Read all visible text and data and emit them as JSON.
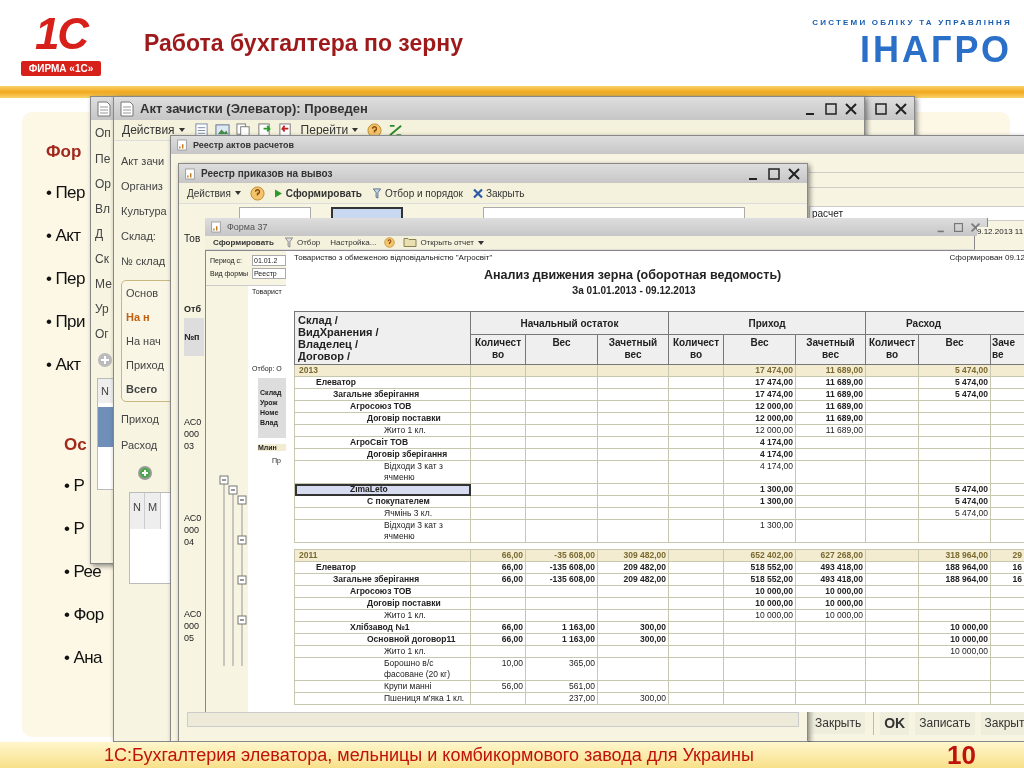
{
  "slide": {
    "title": "Работа бухгалтера по зерну",
    "footer": "1С:Бухгалтерия элеватора, мельницы и комбикормового завода для Украины",
    "page_number": "10"
  },
  "logo_left": {
    "mark": "1С",
    "caption": "ФИРМА «1С»"
  },
  "logo_right": {
    "tagline": "СИСТЕМИ ОБЛІКУ ТА УПРАВЛІННЯ",
    "name": "ІНАГРО"
  },
  "bullets_top": {
    "heading": "Фор",
    "items": [
      "• Пер",
      "• Акт",
      "• Пер",
      "• При",
      "• Акт"
    ]
  },
  "bullets_bottom": {
    "heading": "Ос",
    "items": [
      "• Р",
      "• Р",
      "• Рее",
      "• Фор",
      "• Ана"
    ]
  },
  "window_back": {
    "tab": "Оп",
    "labels": [
      "Пе",
      "Ор",
      "Вл",
      "Д",
      "Ск",
      "Ме",
      "Ур",
      "Ог"
    ],
    "table_header": "N"
  },
  "window_act": {
    "title": "Акт зачистки (Элеватор): Проведен",
    "actions": "Действия",
    "goto": "Перейти",
    "fields": [
      "Акт зачи",
      "Организ",
      "Культура",
      "Склад:",
      "№ склад"
    ],
    "group_tab": "Основ",
    "group_title": "На н",
    "group_rows": [
      "На нач",
      "Приход",
      "Всего"
    ],
    "rows": [
      "Приход",
      "Расход"
    ],
    "table_headers": [
      "N",
      "М"
    ]
  },
  "window_acts_registry": {
    "title": "Реестр актов расчетов",
    "field_value": "расчет",
    "date_text": "9.12.2013 11",
    "close_button": "Закрыть",
    "ok_button": "OK",
    "save_button": "Записать",
    "close_button_2": "Закрыт"
  },
  "window_orders": {
    "title": "Реестр приказов на вывоз",
    "actions": "Действия",
    "generate": "Сформировать",
    "filter": "Отбор и порядок",
    "close": "Закрыть",
    "tab": "Тов",
    "filter_header": "Отб",
    "number_header": "№п",
    "doc_numbers": [
      "АС0\n000\n03",
      "АС0\n000\n04",
      "АС0\n000\n05"
    ]
  },
  "window_form": {
    "title": "Форма 37",
    "generate": "Сформировать",
    "filter": "Отбор",
    "settings": "Настройка...",
    "open_report": "Открыть отчет",
    "period_label": "Период с:",
    "period_value": "01.01.2",
    "form_label": "Вид формы",
    "form_value": "Реестр",
    "preview": {
      "company": "Товарист",
      "filter": "Отбор: О",
      "header": "Склад\nУрож\nНоме\nВлад",
      "group": "Млин",
      "sub": "Пр"
    },
    "report": {
      "company": "Товариство з обмеженою відповідальністю \"Агросвіт\"",
      "generated": "Сформирован 09.12",
      "title": "Анализ движения зерна (оборотная ведомость)",
      "period": "За 01.01.2013 - 09.12.2013",
      "row_header": "Склад /\nВидХранения /\nВладелец /\nДоговор /",
      "groups": [
        "Начальный остаток",
        "Приход",
        "Расход"
      ],
      "columns": [
        "Количест\nво",
        "Вес",
        "Зачетный вес",
        "Количест\nво",
        "Вес",
        "Зачетный вес",
        "Количест\nво",
        "Вес",
        "Заче\nве"
      ],
      "rows": [
        {
          "label": "2013",
          "selected": false,
          "values": {
            "in_weight": "17 474,00",
            "in_credit": "11 689,00",
            "out_weight": "5 474,00"
          },
          "children": [
            {
              "label": "Елеватор",
              "selected": false,
              "values": {
                "in_weight": "17 474,00",
                "in_credit": "11 689,00",
                "out_weight": "5 474,00"
              },
              "children": [
                {
                  "label": "Загальне зберігання",
                  "selected": false,
                  "values": {
                    "in_weight": "17 474,00",
                    "in_credit": "11 689,00",
                    "out_weight": "5 474,00"
                  },
                  "children": [
                    {
                      "label": "Агросоюз ТОВ",
                      "selected": false,
                      "values": {
                        "in_weight": "12 000,00",
                        "in_credit": "11 689,00"
                      },
                      "children": [
                        {
                          "label": "Договір поставки",
                          "selected": false,
                          "values": {
                            "in_weight": "12 000,00",
                            "in_credit": "11 689,00"
                          },
                          "children": [
                            {
                              "label": "Жито 1 кл.",
                              "selected": false,
                              "values": {
                                "in_weight": "12 000,00",
                                "in_credit": "11 689,00"
                              }
                            }
                          ]
                        }
                      ]
                    },
                    {
                      "label": "АгроСвіт ТОВ",
                      "selected": false,
                      "values": {
                        "in_weight": "4 174,00"
                      },
                      "children": [
                        {
                          "label": "Договір зберігання",
                          "selected": false,
                          "values": {
                            "in_weight": "4 174,00"
                          },
                          "children": [
                            {
                              "label": "Відходи 3 кат з ячменю",
                              "selected": false,
                              "values": {
                                "in_weight": "4 174,00"
                              }
                            }
                          ]
                        }
                      ]
                    },
                    {
                      "label": "ZimaLeto",
                      "selected": true,
                      "values": {
                        "in_weight": "1 300,00",
                        "out_weight": "5 474,00"
                      },
                      "children": [
                        {
                          "label": "С покупателем",
                          "selected": false,
                          "values": {
                            "in_weight": "1 300,00",
                            "out_weight": "5 474,00"
                          },
                          "children": [
                            {
                              "label": "Ячмінь 3 кл.",
                              "selected": false,
                              "values": {
                                "out_weight": "5 474,00"
                              }
                            },
                            {
                              "label": "Відходи 3 кат з ячменю",
                              "selected": false,
                              "values": {
                                "in_weight": "1 300,00"
                              }
                            }
                          ]
                        }
                      ]
                    }
                  ]
                }
              ]
            }
          ]
        },
        {
          "label": "2011",
          "selected": false,
          "values": {
            "start_qty": "66,00",
            "start_weight": "-35 608,00",
            "start_credit": "309 482,00",
            "in_weight": "652 402,00",
            "in_credit": "627 268,00",
            "out_weight": "318 964,00",
            "out_credit": "29"
          },
          "children": [
            {
              "label": "Елеватор",
              "selected": false,
              "values": {
                "start_qty": "66,00",
                "start_weight": "-135 608,00",
                "start_credit": "209 482,00",
                "in_weight": "518 552,00",
                "in_credit": "493 418,00",
                "out_weight": "188 964,00",
                "out_credit": "16"
              },
              "children": [
                {
                  "label": "Загальне зберігання",
                  "selected": false,
                  "values": {
                    "start_qty": "66,00",
                    "start_weight": "-135 608,00",
                    "start_credit": "209 482,00",
                    "in_weight": "518 552,00",
                    "in_credit": "493 418,00",
                    "out_weight": "188 964,00",
                    "out_credit": "16"
                  },
                  "children": [
                    {
                      "label": "Агросоюз ТОВ",
                      "selected": false,
                      "values": {
                        "in_weight": "10 000,00",
                        "in_credit": "10 000,00"
                      },
                      "children": [
                        {
                          "label": "Договір поставки",
                          "selected": false,
                          "values": {
                            "in_weight": "10 000,00",
                            "in_credit": "10 000,00"
                          },
                          "children": [
                            {
                              "label": "Жито 1 кл.",
                              "selected": false,
                              "values": {
                                "in_weight": "10 000,00",
                                "in_credit": "10 000,00"
                              }
                            }
                          ]
                        }
                      ]
                    },
                    {
                      "label": "Хлібзавод №1",
                      "selected": false,
                      "values": {
                        "start_qty": "66,00",
                        "start_weight": "1 163,00",
                        "start_credit": "300,00",
                        "out_weight": "10 000,00"
                      },
                      "children": [
                        {
                          "label": "Основной договор11",
                          "selected": false,
                          "values": {
                            "start_qty": "66,00",
                            "start_weight": "1 163,00",
                            "start_credit": "300,00",
                            "out_weight": "10 000,00"
                          },
                          "children": [
                            {
                              "label": "Жито 1 кл.",
                              "selected": false,
                              "values": {
                                "out_weight": "10 000,00"
                              }
                            },
                            {
                              "label": "Борошно в/с фасоване (20 кг)",
                              "selected": false,
                              "values": {
                                "start_qty": "10,00",
                                "start_weight": "365,00"
                              }
                            },
                            {
                              "label": "Крупи манні",
                              "selected": false,
                              "values": {
                                "start_qty": "56,00",
                                "start_weight": "561,00"
                              }
                            },
                            {
                              "label": "Пшениця м'яка 1 кл.",
                              "selected": false,
                              "values": {
                                "start_weight": "237,00",
                                "start_credit": "300,00"
                              }
                            }
                          ]
                        }
                      ]
                    }
                  ]
                }
              ]
            }
          ]
        }
      ]
    }
  }
}
